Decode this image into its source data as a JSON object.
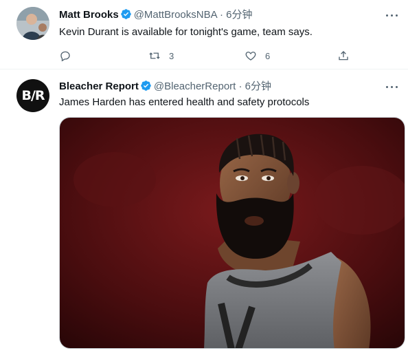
{
  "tweets": [
    {
      "name": "Matt Brooks",
      "handle": "@MattBrooksNBA",
      "dot": "·",
      "time": "6分钟",
      "text": "Kevin Durant is available for tonight's game, team says.",
      "retweets": "3",
      "likes": "6",
      "icons": [
        "reply-icon",
        "retweet-icon",
        "like-icon",
        "share-icon"
      ]
    },
    {
      "name": "Bleacher Report",
      "handle": "@BleacherReport",
      "dot": "·",
      "time": "6分钟",
      "text": "James Harden has entered health and safety protocols",
      "avatar_logo": "B/R",
      "media": "photo of a bearded basketball player in a grey Brooklyn Nets jersey"
    }
  ],
  "colors": {
    "verified": "#1d9bf0",
    "secondary_text": "#536471",
    "text": "#0f1419"
  }
}
